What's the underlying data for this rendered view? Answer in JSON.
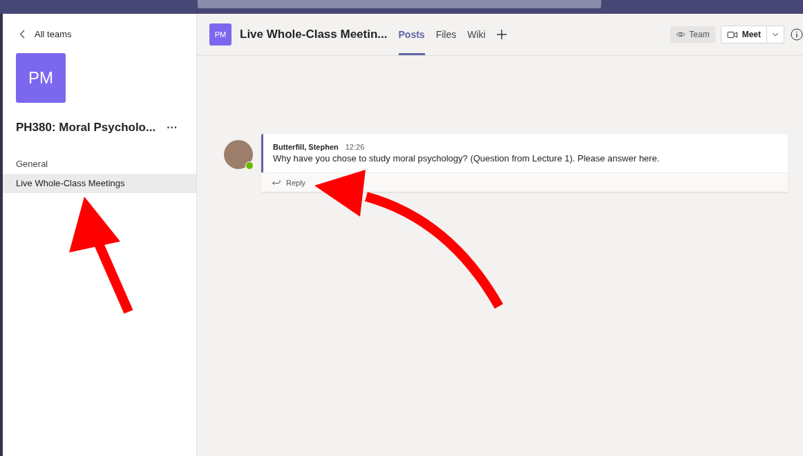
{
  "sidebar": {
    "back_label": "All teams",
    "team_avatar": "PM",
    "team_name": "PH380: Moral Psycholo...",
    "more": "···",
    "channels": [
      {
        "label": "General",
        "selected": false
      },
      {
        "label": "Live Whole-Class Meetings",
        "selected": true
      }
    ]
  },
  "header": {
    "avatar": "PM",
    "title": "Live Whole-Class Meetin...",
    "tabs": [
      {
        "label": "Posts",
        "selected": true
      },
      {
        "label": "Files",
        "selected": false
      },
      {
        "label": "Wiki",
        "selected": false
      }
    ],
    "team_button": "Team",
    "meet_button": "Meet"
  },
  "post": {
    "author": "Butterfill, Stephen",
    "time": "12:26",
    "status_available": true,
    "text": "Why have you chose to study moral psychology? (Question from Lecture 1). Please answer here.",
    "reply": "Reply"
  }
}
